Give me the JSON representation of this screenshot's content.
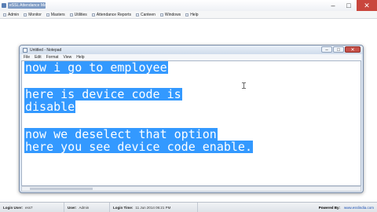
{
  "app": {
    "title": "eSSL Attendance Mana...",
    "window_controls": {
      "minimize": "–",
      "maximize": "□",
      "close": "✕"
    },
    "menu": [
      {
        "label": "Admin",
        "icon": "admin-icon"
      },
      {
        "label": "Monitor",
        "icon": "monitor-icon"
      },
      {
        "label": "Masters",
        "icon": "masters-icon"
      },
      {
        "label": "Utilities",
        "icon": "utilities-icon"
      },
      {
        "label": "Attendance Reports",
        "icon": "reports-icon"
      },
      {
        "label": "Canteen",
        "icon": "canteen-icon"
      },
      {
        "label": "Windows",
        "icon": "windows-icon"
      },
      {
        "label": "Help",
        "icon": "help-icon"
      }
    ]
  },
  "notepad": {
    "title": "Untitled - Notepad",
    "controls": {
      "minimize": "–",
      "maximize": "□",
      "close": "✕"
    },
    "menu": [
      "File",
      "Edit",
      "Format",
      "View",
      "Help"
    ],
    "lines": [
      "now i go to employee",
      "here is device code is",
      "disable",
      "now we deselect that option",
      "here you see device code enable."
    ],
    "selection_color": "#3399ff"
  },
  "statusbar": {
    "login_user_label": "Login User:",
    "login_user_value": "ess7",
    "role_label": "User:",
    "role_value": "Admin",
    "login_time_label": "Login Time:",
    "login_time_value": "11 Jun 2014 06:21 PM",
    "powered_by_label": "Powered By:",
    "powered_by_value": "www.esslindia.com"
  }
}
